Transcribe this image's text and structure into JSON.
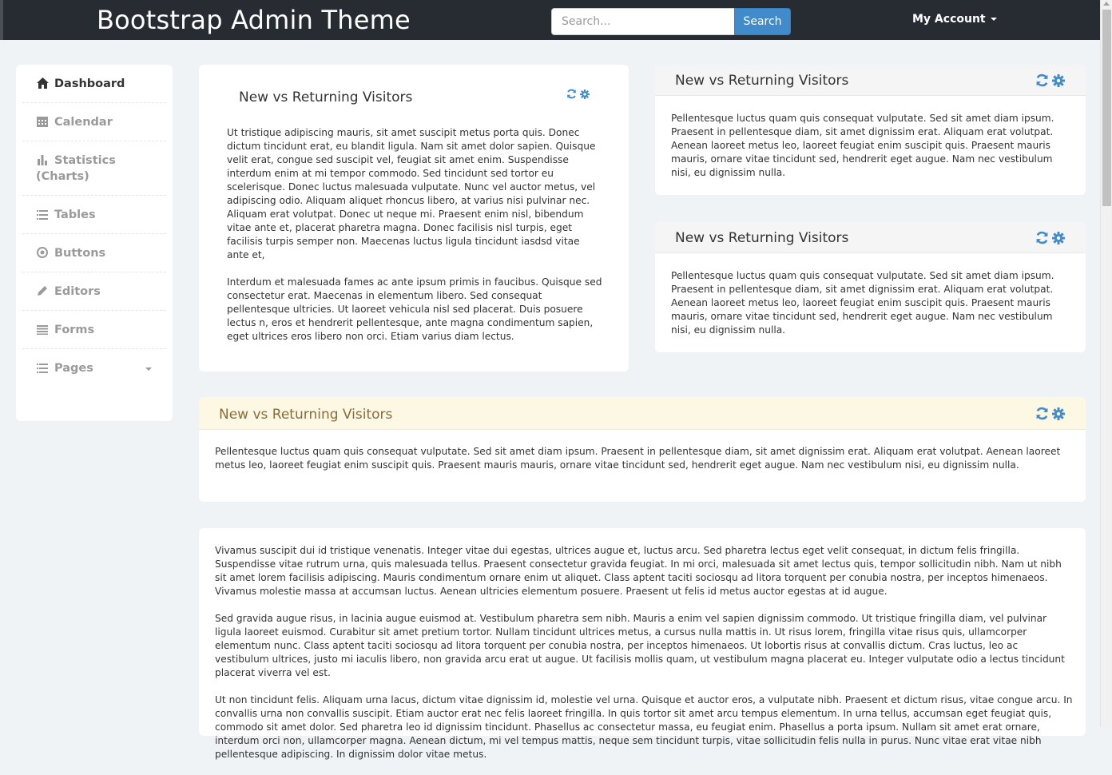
{
  "navbar": {
    "brand": "Bootstrap Admin Theme",
    "search_placeholder": "Search...",
    "search_button": "Search",
    "account_label": "My Account"
  },
  "sidebar": {
    "items": [
      {
        "label": "Dashboard",
        "icon": "home-icon"
      },
      {
        "label": "Calendar",
        "icon": "calendar-icon"
      },
      {
        "label": "Statistics (Charts)",
        "icon": "bar-chart-icon"
      },
      {
        "label": "Tables",
        "icon": "list-icon"
      },
      {
        "label": "Buttons",
        "icon": "record-icon"
      },
      {
        "label": "Editors",
        "icon": "pencil-icon"
      },
      {
        "label": "Forms",
        "icon": "forms-icon"
      },
      {
        "label": "Pages",
        "icon": "list-icon"
      }
    ]
  },
  "panel_main": {
    "title": "New vs Returning Visitors",
    "para1": "Ut tristique adipiscing mauris, sit amet suscipit metus porta quis. Donec dictum tincidunt erat, eu blandit ligula. Nam sit amet dolor sapien. Quisque velit erat, congue sed suscipit vel, feugiat sit amet enim. Suspendisse interdum enim at mi tempor commodo. Sed tincidunt sed tortor eu scelerisque. Donec luctus malesuada vulputate. Nunc vel auctor metus, vel adipiscing odio. Aliquam aliquet rhoncus libero, at varius nisi pulvinar nec. Aliquam erat volutpat. Donec ut neque mi. Praesent enim nisl, bibendum vitae ante et, placerat pharetra magna. Donec facilisis nisl turpis, eget facilisis turpis semper non. Maecenas luctus ligula tincidunt iasdsd vitae ante et,",
    "para2": "Interdum et malesuada fames ac ante ipsum primis in faucibus. Quisque sed consectetur erat. Maecenas in elementum libero. Sed consequat pellentesque ultricies. Ut laoreet vehicula nisl sed placerat. Duis posuere lectus n, eros et hendrerit pellentesque, ante magna condimentum sapien, eget ultrices eros libero non orci. Etiam varius diam lectus."
  },
  "panel_right_1": {
    "title": "New vs Returning Visitors",
    "body": "Pellentesque luctus quam quis consequat vulputate. Sed sit amet diam ipsum. Praesent in pellentesque diam, sit amet dignissim erat. Aliquam erat volutpat. Aenean laoreet metus leo, laoreet feugiat enim suscipit quis. Praesent mauris mauris, ornare vitae tincidunt sed, hendrerit eget augue. Nam nec vestibulum nisi, eu dignissim nulla."
  },
  "panel_right_2": {
    "title": "New vs Returning Visitors",
    "body": "Pellentesque luctus quam quis consequat vulputate. Sed sit amet diam ipsum. Praesent in pellentesque diam, sit amet dignissim erat. Aliquam erat volutpat. Aenean laoreet metus leo, laoreet feugiat enim suscipit quis. Praesent mauris mauris, ornare vitae tincidunt sed, hendrerit eget augue. Nam nec vestibulum nisi, eu dignissim nulla."
  },
  "panel_wide": {
    "title": "New vs Returning Visitors",
    "body": "Pellentesque luctus quam quis consequat vulputate. Sed sit amet diam ipsum. Praesent in pellentesque diam, sit amet dignissim erat. Aliquam erat volutpat. Aenean laoreet metus leo, laoreet feugiat enim suscipit quis. Praesent mauris mauris, ornare vitae tincidunt sed, hendrerit eget augue. Nam nec vestibulum nisi, eu dignissim nulla."
  },
  "panel_text": {
    "para1": "Vivamus suscipit dui id tristique venenatis. Integer vitae dui egestas, ultrices augue et, luctus arcu. Sed pharetra lectus eget velit consequat, in dictum felis fringilla. Suspendisse vitae rutrum urna, quis malesuada tellus. Praesent consectetur gravida feugiat. In mi orci, malesuada sit amet lectus quis, tempor sollicitudin nibh. Nam ut nibh sit amet lorem facilisis adipiscing. Mauris condimentum ornare enim ut aliquet. Class aptent taciti sociosqu ad litora torquent per conubia nostra, per inceptos himenaeos. Vivamus molestie massa at accumsan luctus. Aenean ultricies elementum posuere. Praesent ut felis id metus auctor egestas at id augue.",
    "para2": "Sed gravida augue risus, in lacinia augue euismod at. Vestibulum pharetra sem nibh. Mauris a enim vel sapien dignissim commodo. Ut tristique fringilla diam, vel pulvinar ligula laoreet euismod. Curabitur sit amet pretium tortor. Nullam tincidunt ultrices metus, a cursus nulla mattis in. Ut risus lorem, fringilla vitae risus quis, ullamcorper elementum nunc. Class aptent taciti sociosqu ad litora torquent per conubia nostra, per inceptos himenaeos. Ut lobortis risus at convallis dictum. Cras luctus, leo ac vestibulum ultrices, justo mi iaculis libero, non gravida arcu erat ut augue. Ut facilisis mollis quam, ut vestibulum magna placerat eu. Integer vulputate odio a lectus tincidunt placerat viverra vel est.",
    "para3": "Ut non tincidunt felis. Aliquam urna lacus, dictum vitae dignissim id, molestie vel urna. Quisque et auctor eros, a vulputate nibh. Praesent et dictum risus, vitae congue arcu. In convallis urna non convallis suscipit. Etiam auctor erat nec felis laoreet fringilla. In quis tortor sit amet arcu tempus elementum. In urna tellus, accumsan eget feugiat quis, commodo sit amet dolor. Sed pharetra leo id dignissim tincidunt. Phasellus ac consectetur massa, eu feugiat enim. Phasellus a porta ipsum. Nullam sit amet erat ornare, interdum orci non, ullamcorper magna. Aenean dictum, mi vel tempus mattis, neque sem tincidunt turpis, vitae sollicitudin felis nulla in purus. Nunc vitae erat vitae nibh pellentesque adipiscing. In dignissim dolor vitae metus."
  },
  "colors": {
    "navbar": "#262c32",
    "accent": "#428bca",
    "page_bg": "#eff3f6",
    "warning_heading": "#fcf8e3"
  }
}
